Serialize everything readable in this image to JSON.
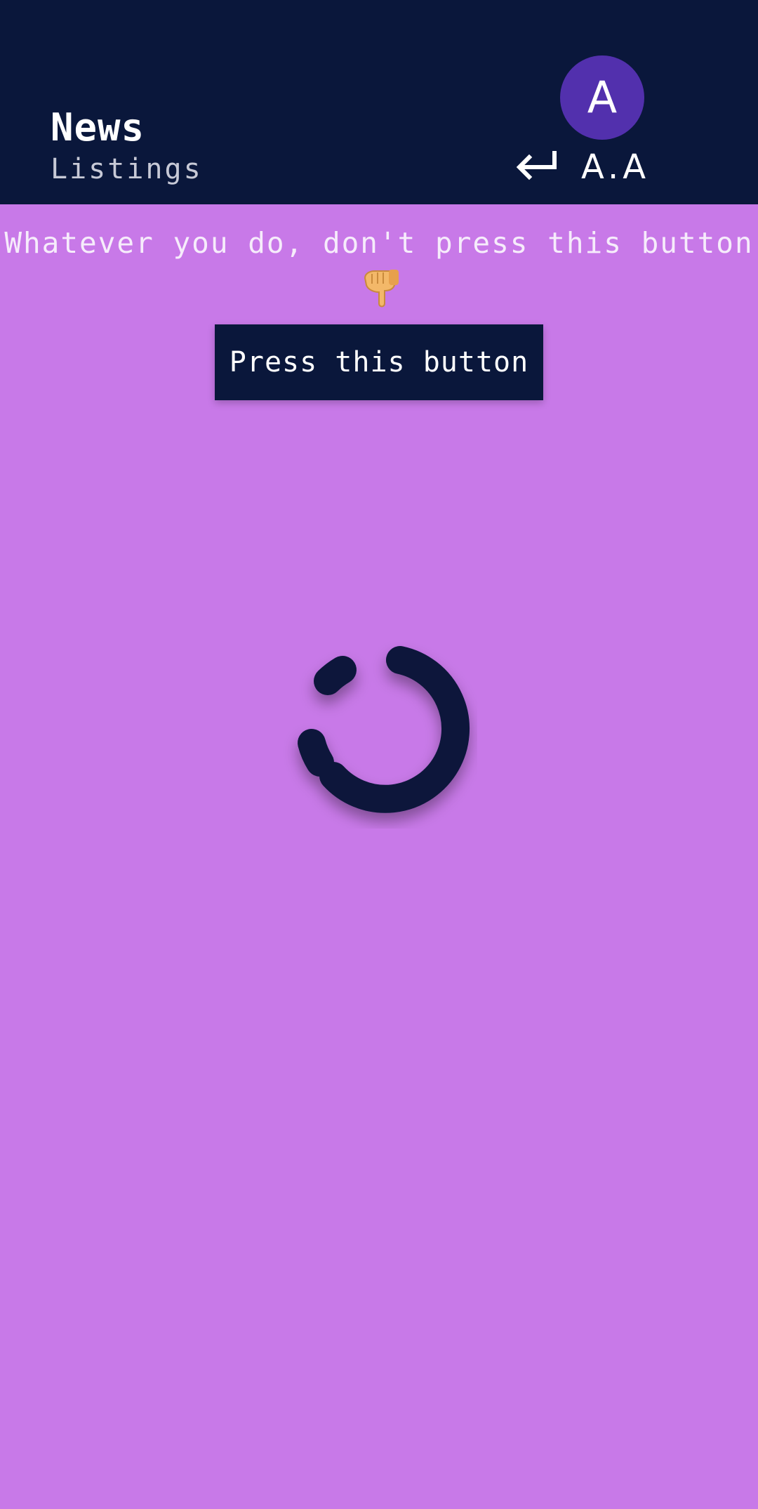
{
  "header": {
    "title": "News",
    "subtitle": "Listings",
    "avatar_letter": "A",
    "user_initials": "A.A",
    "icons": {
      "back": "return-arrow-icon"
    }
  },
  "main": {
    "warning_text": "Whatever you do, don't press this button",
    "pointer_icon": "backhand-index-pointing-down-icon",
    "button_label": "Press this button",
    "loading_indicator": "spinner-icon"
  },
  "colors": {
    "header_bg": "#0a173b",
    "page_bg": "#c879e8",
    "avatar_bg": "#5230ad",
    "button_bg": "#0a173b",
    "spinner": "#0a173b"
  }
}
